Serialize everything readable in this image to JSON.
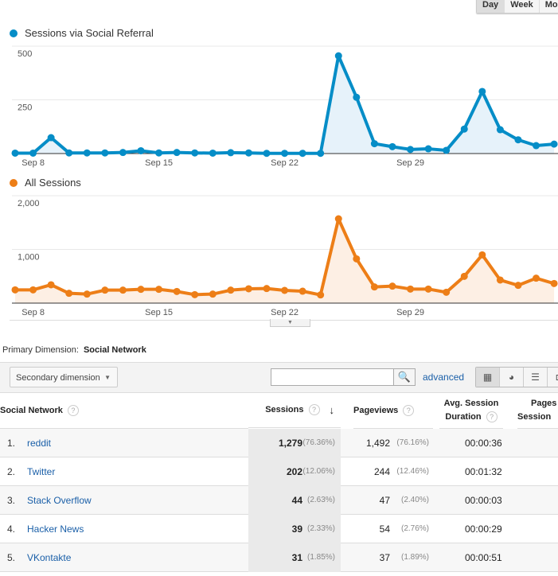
{
  "interval_buttons": [
    "Day",
    "Week",
    "Month"
  ],
  "interval_selected": "Day",
  "chart_data": [
    {
      "type": "area",
      "title": "Sessions via Social Referral",
      "series": [
        {
          "name": "Sessions via Social Referral",
          "color": "#058dc7",
          "values": [
            2,
            2,
            74,
            3,
            3,
            3,
            5,
            13,
            3,
            5,
            3,
            2,
            4,
            3,
            1,
            1,
            1,
            1,
            455,
            262,
            46,
            32,
            19,
            22,
            15,
            114,
            289,
            111,
            64,
            37,
            44
          ]
        }
      ],
      "x_start": "Sep 7",
      "x_end": "Oct 7",
      "x_tick_labels": [
        "Sep 8",
        "Sep 15",
        "Sep 22",
        "Sep 29"
      ],
      "y_tick_labels": [
        "500",
        "250"
      ],
      "ylim": [
        0,
        500
      ],
      "grid": true
    },
    {
      "type": "area",
      "title": "All Sessions",
      "series": [
        {
          "name": "All Sessions",
          "color": "#ed7e17",
          "values": [
            247,
            247,
            341,
            183,
            168,
            242,
            242,
            257,
            257,
            217,
            158,
            168,
            242,
            267,
            272,
            237,
            222,
            153,
            1570,
            825,
            301,
            316,
            262,
            262,
            202,
            499,
            899,
            430,
            331,
            464,
            365
          ]
        }
      ],
      "x_start": "Sep 7",
      "x_end": "Oct 7",
      "x_tick_labels": [
        "Sep 8",
        "Sep 15",
        "Sep 22",
        "Sep 29"
      ],
      "y_tick_labels": [
        "2,000",
        "1,000"
      ],
      "ylim": [
        0,
        2000
      ],
      "grid": true
    }
  ],
  "primary_dimension": {
    "label": "Primary Dimension:",
    "value": "Social Network"
  },
  "toolbar": {
    "secondary_dimension": "Secondary dimension",
    "search_value": "",
    "advanced": "advanced"
  },
  "table": {
    "headers": {
      "name": "Social Network",
      "sessions": "Sessions",
      "pageviews": "Pageviews",
      "duration_1": "Avg. Session",
      "duration_2": "Duration",
      "pages_1": "Pages /",
      "pages_2": "Session"
    },
    "rows": [
      {
        "n": "1.",
        "name": "reddit",
        "sessions": "1,279",
        "sessions_pct": "(76.36%)",
        "pageviews": "1,492",
        "pageviews_pct": "(76.16%)",
        "duration": "00:00:36"
      },
      {
        "n": "2.",
        "name": "Twitter",
        "sessions": "202",
        "sessions_pct": "(12.06%)",
        "pageviews": "244",
        "pageviews_pct": "(12.46%)",
        "duration": "00:01:32"
      },
      {
        "n": "3.",
        "name": "Stack Overflow",
        "sessions": "44",
        "sessions_pct": "(2.63%)",
        "pageviews": "47",
        "pageviews_pct": "(2.40%)",
        "duration": "00:00:03"
      },
      {
        "n": "4.",
        "name": "Hacker News",
        "sessions": "39",
        "sessions_pct": "(2.33%)",
        "pageviews": "54",
        "pageviews_pct": "(2.76%)",
        "duration": "00:00:29"
      },
      {
        "n": "5.",
        "name": "VKontakte",
        "sessions": "31",
        "sessions_pct": "(1.85%)",
        "pageviews": "37",
        "pageviews_pct": "(1.89%)",
        "duration": "00:00:51"
      }
    ]
  }
}
